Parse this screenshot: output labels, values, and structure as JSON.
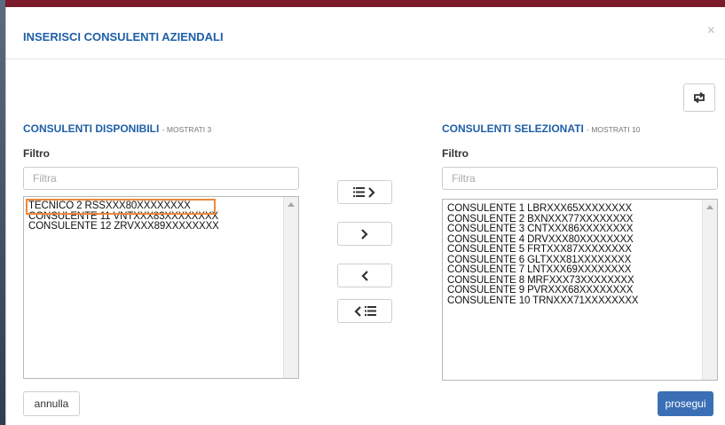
{
  "modal": {
    "title": "INSERISCI CONSULENTI AZIENDALI",
    "close_label": "×"
  },
  "available": {
    "title": "CONSULENTI DISPONIBILI",
    "count_label": "- MOSTRATI 3",
    "filter_label": "Filtro",
    "filter_placeholder": "Filtra",
    "items": [
      "TECNICO 2  RSSXXX80XXXXXXXX",
      "CONSULENTE 11  VNTXXX83XXXXXXXX",
      "CONSULENTE 12  ZRVXXX89XXXXXXXX"
    ]
  },
  "selected": {
    "title": "CONSULENTI SELEZIONATI",
    "count_label": "- MOSTRATI 10",
    "filter_label": "Filtro",
    "filter_placeholder": "Filtra",
    "items": [
      "CONSULENTE 1  LBRXXX65XXXXXXXX",
      "CONSULENTE 2  BXNXXX77XXXXXXXX",
      "CONSULENTE 3  CNTXXX86XXXXXXXX",
      "CONSULENTE 4  DRVXXX80XXXXXXXX",
      "CONSULENTE 5  FRTXXX87XXXXXXXX",
      "CONSULENTE 6  GLTXXX81XXXXXXXX",
      "CONSULENTE 7  LNTXXX69XXXXXXXX",
      "CONSULENTE 8  MRFXXX73XXXXXXXX",
      "CONSULENTE 9  PVRXXX68XXXXXXXX",
      "CONSULENTE 10  TRNXXX71XXXXXXXX"
    ]
  },
  "actions": {
    "annulla_label": "annulla",
    "prosegui_label": "prosegui"
  },
  "colors": {
    "accent": "#1f5fa8",
    "primary_button": "#3a6fb5",
    "highlight_outline": "#f0883a"
  }
}
